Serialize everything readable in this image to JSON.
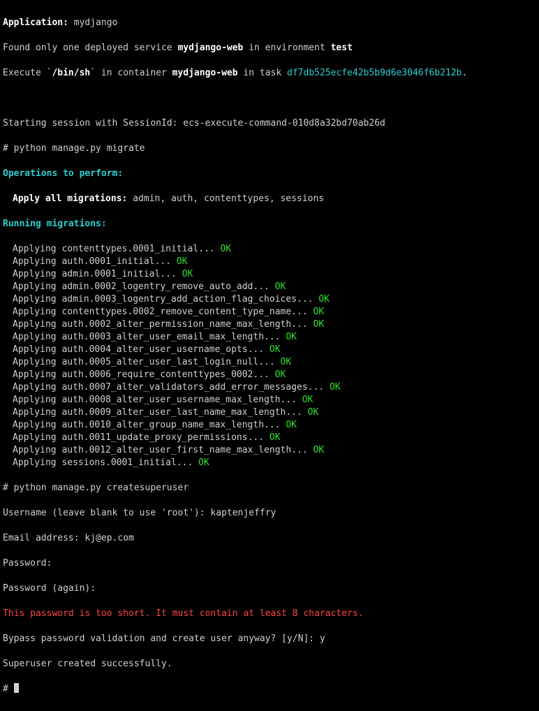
{
  "header": {
    "app_label": "Application:",
    "app_name": "mydjango",
    "found_prefix": "Found only one deployed service ",
    "service": "mydjango-web",
    "found_mid": " in environment ",
    "env": "test",
    "exec_prefix": "Execute `",
    "shell": "/bin/sh",
    "exec_mid": "` in container ",
    "container": "mydjango-web",
    "exec_mid2": " in task ",
    "task_id": "df7db525ecfe42b5b9d6e3046f6b212b",
    "period": "."
  },
  "session_line": "Starting session with SessionId: ecs-execute-command-010d8a32bd70ab26d",
  "cmds": {
    "migrate": "# python manage.py migrate",
    "createsuperuser": "# python manage.py createsuperuser"
  },
  "ops_header": "Operations to perform:",
  "apply_all_label": "Apply all migrations:",
  "apply_all_list": " admin, auth, contenttypes, sessions",
  "running_header": "Running migrations:",
  "applying_word": "Applying ",
  "ellipsis": "... ",
  "ok": "OK",
  "migrations": [
    "contenttypes.0001_initial",
    "auth.0001_initial",
    "admin.0001_initial",
    "admin.0002_logentry_remove_auto_add",
    "admin.0003_logentry_add_action_flag_choices",
    "contenttypes.0002_remove_content_type_name",
    "auth.0002_alter_permission_name_max_length",
    "auth.0003_alter_user_email_max_length",
    "auth.0004_alter_user_username_opts",
    "auth.0005_alter_user_last_login_null",
    "auth.0006_require_contenttypes_0002",
    "auth.0007_alter_validators_add_error_messages",
    "auth.0008_alter_user_username_max_length",
    "auth.0009_alter_user_last_name_max_length",
    "auth.0010_alter_group_name_max_length",
    "auth.0011_update_proxy_permissions",
    "auth.0012_alter_user_first_name_max_length",
    "sessions.0001_initial"
  ],
  "su": {
    "username_prompt": "Username (leave blank to use 'root'): ",
    "username": "kaptenjeffry",
    "email_prompt": "Email address: ",
    "email": "kj@ep.com",
    "pw1": "Password:",
    "pw2": "Password (again):",
    "error": "This password is too short. It must contain at least 8 characters.",
    "bypass_prompt": "Bypass password validation and create user anyway? [y/N]: ",
    "bypass_answer": "y",
    "success": "Superuser created successfully."
  },
  "final_prompt": "# "
}
